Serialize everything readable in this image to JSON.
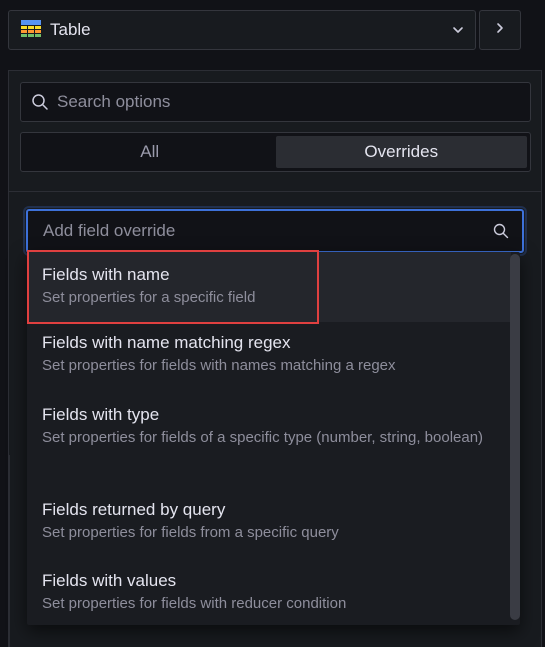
{
  "visualization": {
    "name": "Table",
    "icon": "table-icon"
  },
  "options": {
    "search_placeholder": "Search options",
    "tabs": [
      {
        "label": "All",
        "active": false
      },
      {
        "label": "Overrides",
        "active": true
      }
    ]
  },
  "override_combo": {
    "placeholder": "Add field override"
  },
  "override_options": [
    {
      "title": "Fields with name",
      "description": "Set properties for a specific field"
    },
    {
      "title": "Fields with name matching regex",
      "description": "Set properties for fields with names matching a regex"
    },
    {
      "title": "Fields with type",
      "description": "Set properties for fields of a specific type (number, string, boolean)"
    },
    {
      "title": "Fields returned by query",
      "description": "Set properties for fields from a specific query"
    },
    {
      "title": "Fields with values",
      "description": "Set properties for fields with reducer condition"
    }
  ],
  "colors": {
    "accent_focus": "#3d71d9",
    "highlight_box": "#e04040",
    "background": "#111217",
    "panel": "#181b1f"
  }
}
